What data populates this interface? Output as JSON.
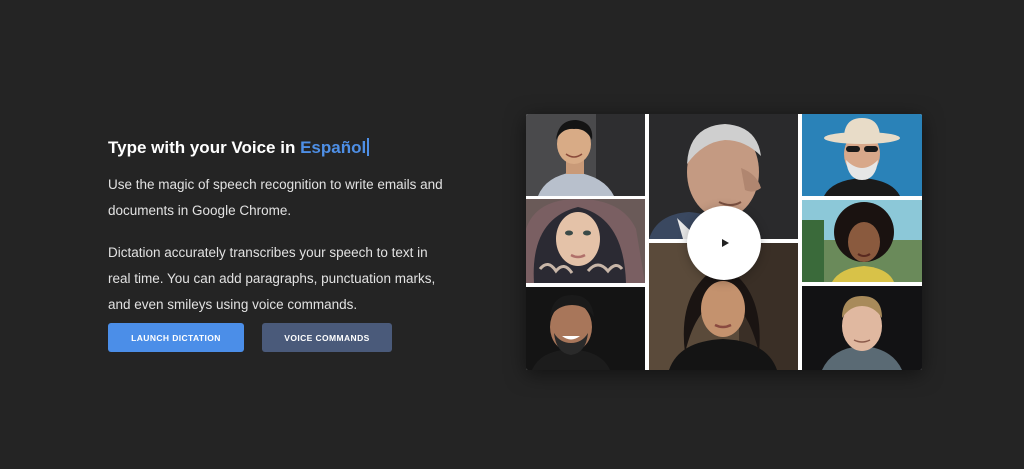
{
  "hero": {
    "headline_prefix": "Type with your Voice in",
    "headline_language": "Español",
    "description_1": "Use the magic of speech recognition to write emails and documents in Google Chrome.",
    "description_2": "Dictation accurately transcribes your speech to text in real time. You can add paragraphs, punctuation marks, and even smileys using voice commands."
  },
  "buttons": {
    "launch_label": "LAUNCH DICTATION",
    "commands_label": "VOICE COMMANDS"
  },
  "colors": {
    "page_background": "#242424",
    "accent": "#4e8fe6",
    "primary_button": "#4b8ee8",
    "secondary_button": "#4a5a7a"
  },
  "video": {
    "play_icon": "play-icon",
    "portraits": [
      "portrait-young-man",
      "portrait-elderly-man",
      "portrait-cowboy-hat-man",
      "portrait-woman-headscarf",
      "portrait-woman-curly-hair",
      "portrait-smiling-man",
      "portrait-woman-dark-hair",
      "portrait-blond-man"
    ]
  }
}
